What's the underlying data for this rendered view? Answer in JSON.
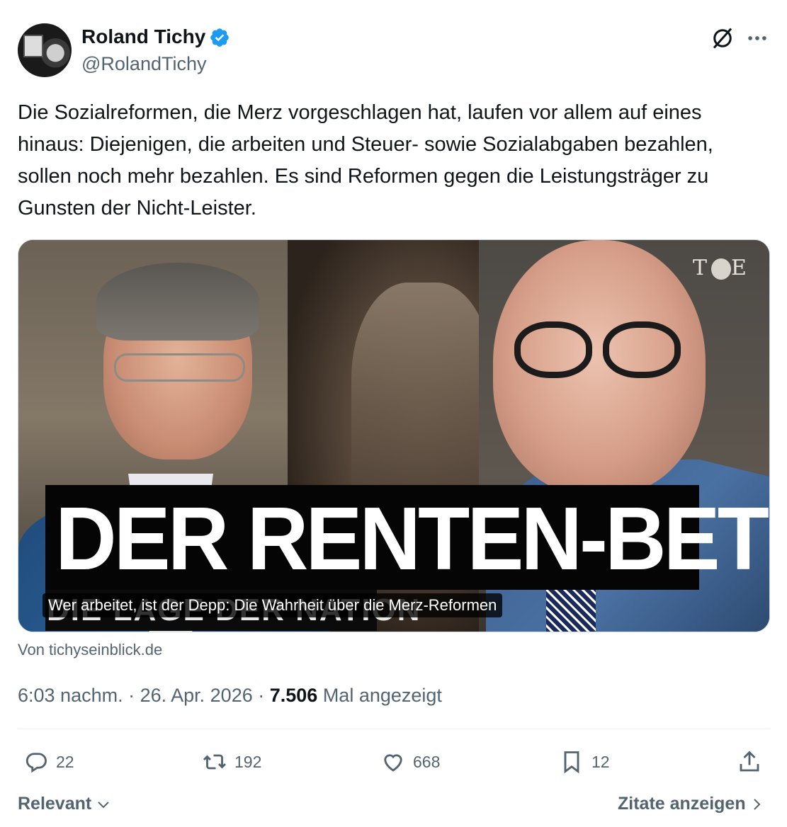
{
  "author": {
    "name": "Roland Tichy",
    "handle": "@RolandTichy",
    "verified_color": "#1d9bf0"
  },
  "tweet": {
    "text": "Die Sozialreformen, die Merz vorgeschlagen hat, laufen vor allem auf eines hinaus: Diejenigen, die arbeiten und Steuer- sowie Sozialabgaben bezahlen, sollen noch mehr bezahlen. Es sind Reformen gegen die Leistungsträger zu Gunsten der Nicht-Leister."
  },
  "card": {
    "headline_image_text": "DER RENTEN-BETRUG",
    "sub_image_text": "DIE LAGE DER NATION",
    "logo_text": "E",
    "caption": "Wer arbeitet, ist der Depp: Die Wahrheit über die Merz-Reformen",
    "source": "Von tichyseinblick.de"
  },
  "meta": {
    "time": "6:03 nachm.",
    "sep1": " · ",
    "date": "26. Apr. 2026",
    "sep2": " · ",
    "views": "7.506",
    "views_label": " Mal angezeigt"
  },
  "actions": {
    "replies": "22",
    "reposts": "192",
    "likes": "668",
    "bookmarks": "12"
  },
  "icons": [
    "verified-badge-icon",
    "grok-icon",
    "more-icon",
    "reply-icon",
    "repost-icon",
    "like-icon",
    "bookmark-icon",
    "share-icon",
    "chevron-down-icon",
    "chevron-right-icon"
  ],
  "footer": {
    "sort_label": "Relevant",
    "quotes_label": "Zitate anzeigen"
  }
}
